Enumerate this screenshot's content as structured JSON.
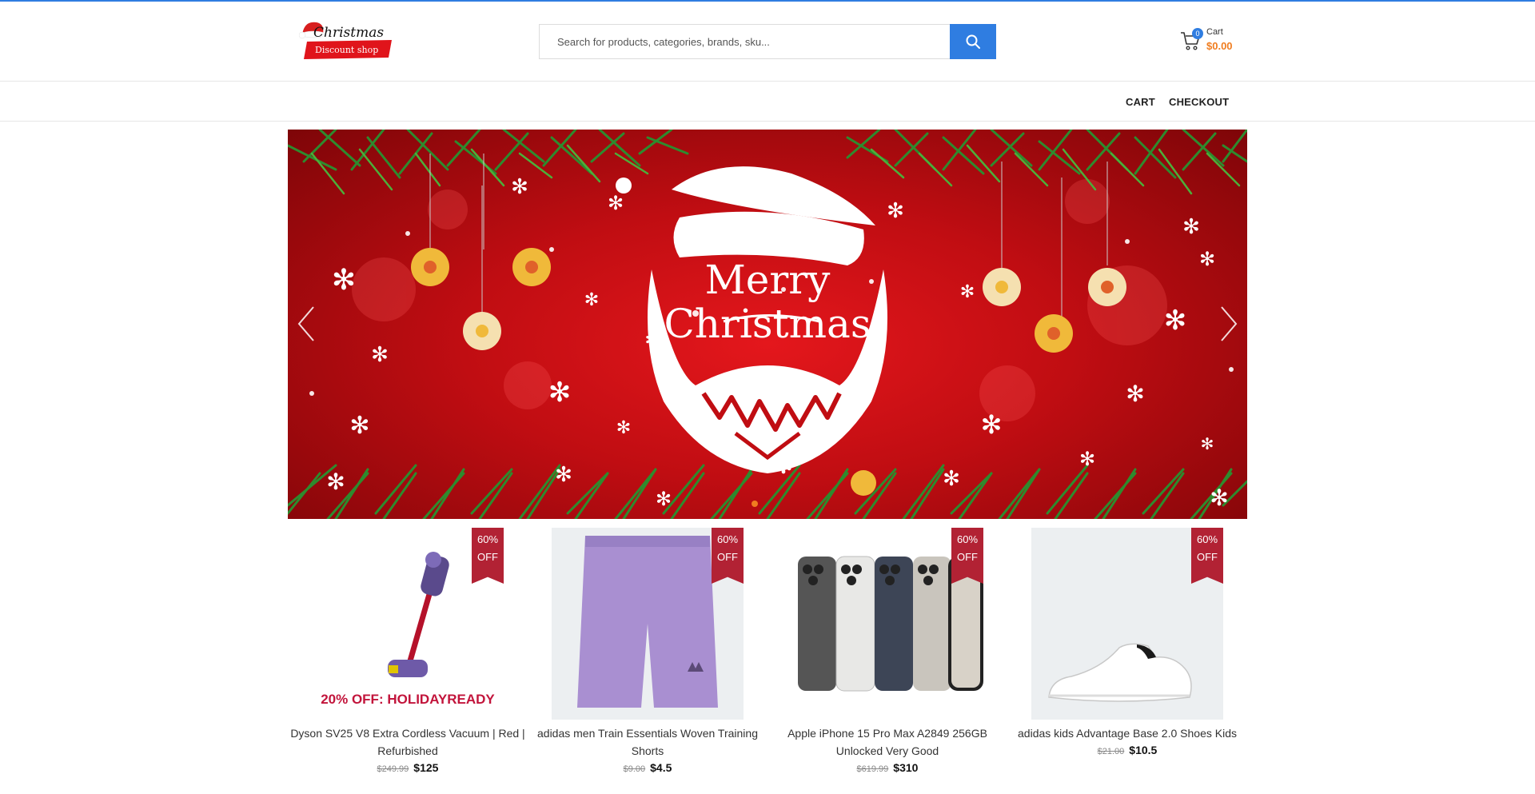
{
  "header": {
    "logo_text_top": "Christmas",
    "logo_text_bottom": "Discount shop",
    "search_placeholder": "Search for products, categories, brands, sku...",
    "cart_label": "Cart",
    "cart_count": "0",
    "cart_total": "$0.00"
  },
  "nav": {
    "cart": "CART",
    "checkout": "CHECKOUT"
  },
  "banner": {
    "headline_line1": "Merry",
    "headline_line2": "Christmas",
    "slide_count": 1,
    "active_slide": 1
  },
  "colors": {
    "accent": "#2f7de1",
    "price_orange": "#f07d20",
    "ribbon": "#b22234",
    "promo": "#c2143b"
  },
  "products": [
    {
      "discount_line1": "60%",
      "discount_line2": "OFF",
      "title": "Dyson SV25 V8 Extra Cordless Vacuum | Red | Refurbished",
      "old_price": "$249.99",
      "new_price": "$125",
      "promo": "20% OFF: HOLIDAYREADY",
      "image": "vacuum-image"
    },
    {
      "discount_line1": "60%",
      "discount_line2": "OFF",
      "title": "adidas men Train Essentials Woven Training Shorts",
      "old_price": "$9.00",
      "new_price": "$4.5",
      "image": "shorts-image"
    },
    {
      "discount_line1": "60%",
      "discount_line2": "OFF",
      "title": "Apple iPhone 15 Pro Max A2849 256GB Unlocked Very Good",
      "old_price": "$619.99",
      "new_price": "$310",
      "image": "phones-image"
    },
    {
      "discount_line1": "60%",
      "discount_line2": "OFF",
      "title": "adidas kids Advantage Base 2.0 Shoes Kids",
      "old_price": "$21.00",
      "new_price": "$10.5",
      "image": "shoe-image"
    }
  ]
}
